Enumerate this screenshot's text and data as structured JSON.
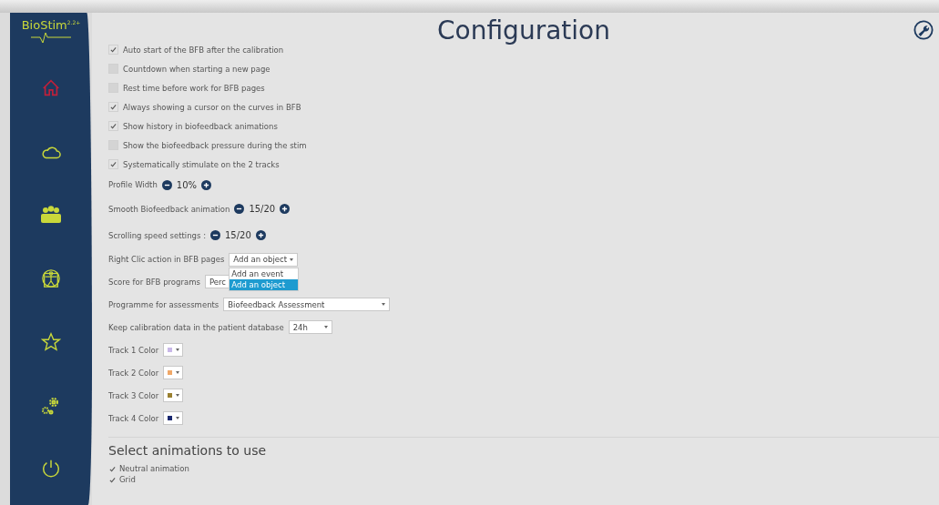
{
  "app": {
    "name": "BioStim",
    "version": "2.2+"
  },
  "title": "Configuration",
  "sidebar": {
    "items": [
      {
        "kind": "home",
        "selected": true
      },
      {
        "kind": "cloud",
        "selected": false
      },
      {
        "kind": "patients",
        "selected": false
      },
      {
        "kind": "body",
        "selected": false
      },
      {
        "kind": "star",
        "selected": false
      },
      {
        "kind": "settings",
        "selected": false
      },
      {
        "kind": "power",
        "selected": false
      }
    ]
  },
  "options": [
    {
      "label": "Auto start of the BFB after the calibration",
      "checked": true
    },
    {
      "label": "Countdown when starting a new page",
      "checked": false
    },
    {
      "label": "Rest time before work for BFB pages",
      "checked": false
    },
    {
      "label": "Always showing a cursor on the curves in BFB",
      "checked": true
    },
    {
      "label": "Show history in biofeedback animations",
      "checked": true
    },
    {
      "label": "Show the biofeedback pressure during the stim",
      "checked": false
    },
    {
      "label": "Systematically stimulate on the 2 tracks",
      "checked": true
    }
  ],
  "steppers": [
    {
      "label": "Profile Width",
      "value": "10%"
    },
    {
      "label": "Smooth Biofeedback animation",
      "value": "15/20"
    },
    {
      "label": "Scrolling speed settings :",
      "value": "15/20"
    }
  ],
  "right_click": {
    "label": "Right Clic action in BFB pages",
    "value": "Add an object",
    "menu": [
      {
        "label": "Add an event",
        "selected": false
      },
      {
        "label": "Add an object",
        "selected": true
      }
    ]
  },
  "score": {
    "label": "Score for BFB programs",
    "value": "Perc"
  },
  "programme": {
    "label": "Programme for assessments",
    "value": "Biofeedback Assessment"
  },
  "calibration": {
    "label": "Keep calibration data in the patient database",
    "value": "24h"
  },
  "tracks": [
    {
      "label": "Track 1 Color",
      "color": "#c9b8e8"
    },
    {
      "label": "Track 2 Color",
      "color": "#f0a868"
    },
    {
      "label": "Track 3 Color",
      "color": "#9a8030"
    },
    {
      "label": "Track 4 Color",
      "color": "#1a2870"
    }
  ],
  "animations": {
    "title": "Select animations to use",
    "items": [
      {
        "label": "Neutral animation",
        "checked": true
      },
      {
        "label": "Grid",
        "checked": true
      }
    ]
  }
}
